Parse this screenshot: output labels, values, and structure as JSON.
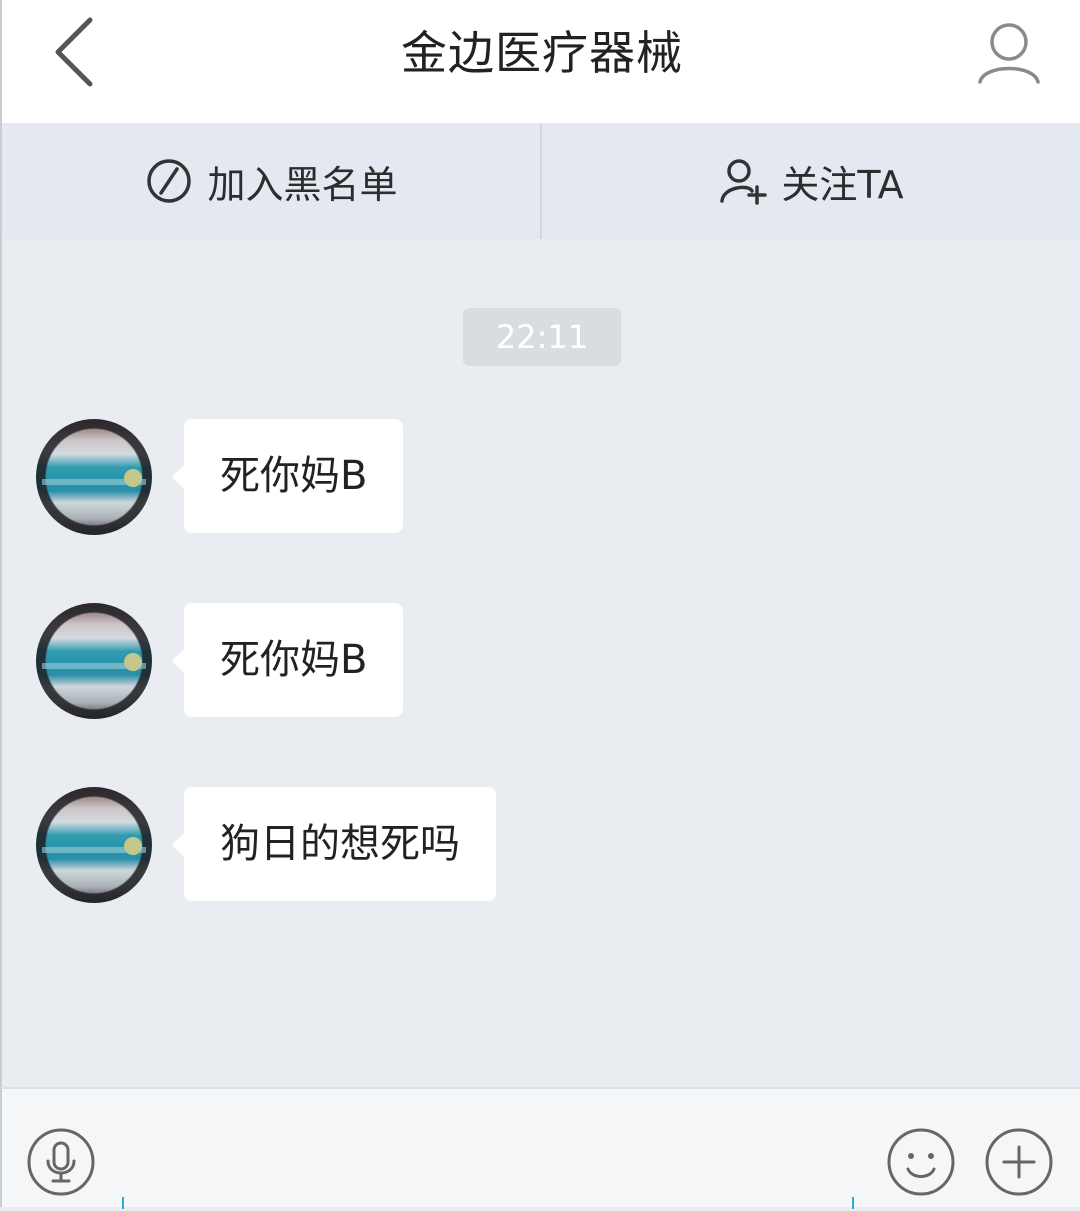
{
  "header": {
    "title": "金边医疗器械",
    "back_icon": "back-chevron-icon",
    "profile_icon": "user-profile-icon"
  },
  "actions": {
    "blacklist_label": "加入黑名单",
    "blacklist_icon": "block-icon",
    "follow_label": "关注TA",
    "follow_icon": "add-user-icon"
  },
  "chat": {
    "timestamp": "22:11",
    "messages": [
      {
        "text": "死你妈B",
        "sender": "contact"
      },
      {
        "text": "死你妈B",
        "sender": "contact"
      },
      {
        "text": "狗日的想死吗",
        "sender": "contact"
      }
    ]
  },
  "input_bar": {
    "voice_icon": "microphone-icon",
    "emoji_icon": "smiley-icon",
    "more_icon": "plus-icon",
    "input_value": ""
  },
  "colors": {
    "header_bg": "#ffffff",
    "action_bar_bg": "#e3e8f1",
    "chat_bg": "#e9ecf1",
    "bubble_bg": "#ffffff",
    "timestamp_bg": "#d9dde2",
    "input_bar_bg": "#f5f6f8",
    "cursor_accent": "#28b0d0"
  }
}
